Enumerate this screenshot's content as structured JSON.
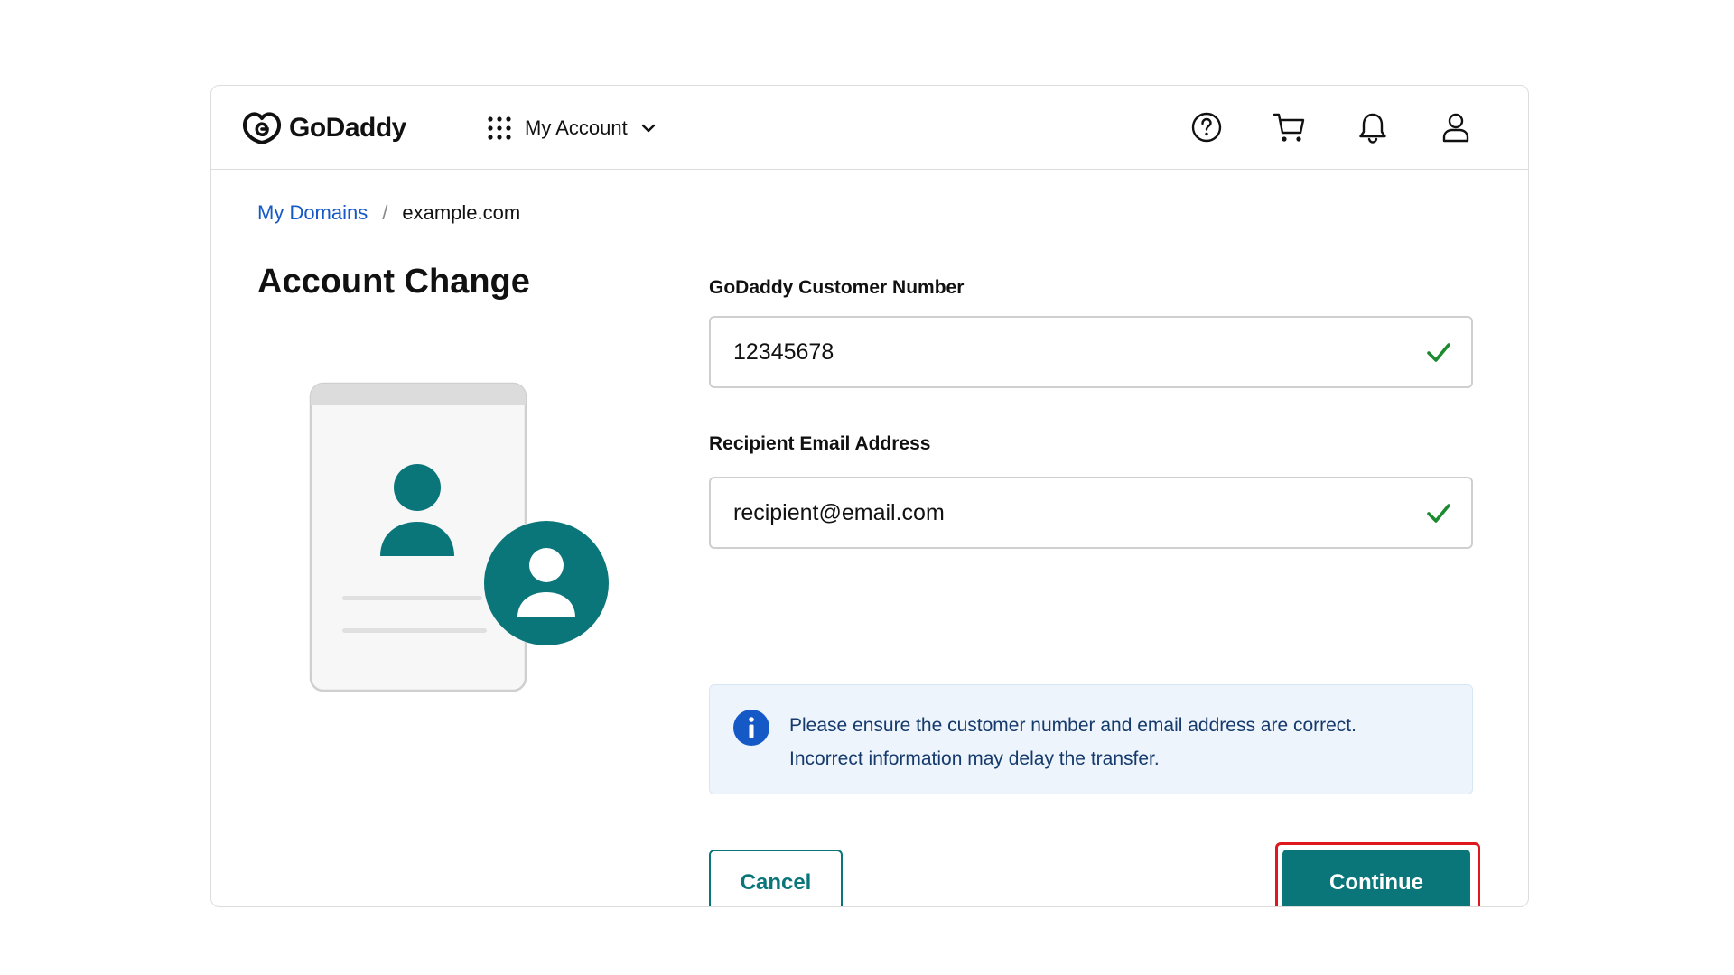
{
  "header": {
    "brand": "GoDaddy",
    "menu_label": "My Account",
    "icons": [
      "help-icon",
      "cart-icon",
      "bell-icon",
      "user-icon"
    ]
  },
  "breadcrumb": {
    "link": "My Domains",
    "separator": "/",
    "current": "example.com"
  },
  "page": {
    "title": "Account Change"
  },
  "form": {
    "customer_number_label": "GoDaddy Customer Number",
    "customer_number_value": "12345678",
    "email_label": "Recipient Email Address",
    "email_value": "recipient@email.com",
    "info_line1": "Please ensure the customer number and email address are correct.",
    "info_line2": "Incorrect information may delay the transfer.",
    "cancel_label": "Cancel",
    "continue_label": "Continue"
  },
  "colors": {
    "accent": "#0b767a",
    "link": "#1559c6",
    "valid": "#1c8a2e",
    "info": "#1559c6",
    "highlight": "#e0171c"
  }
}
